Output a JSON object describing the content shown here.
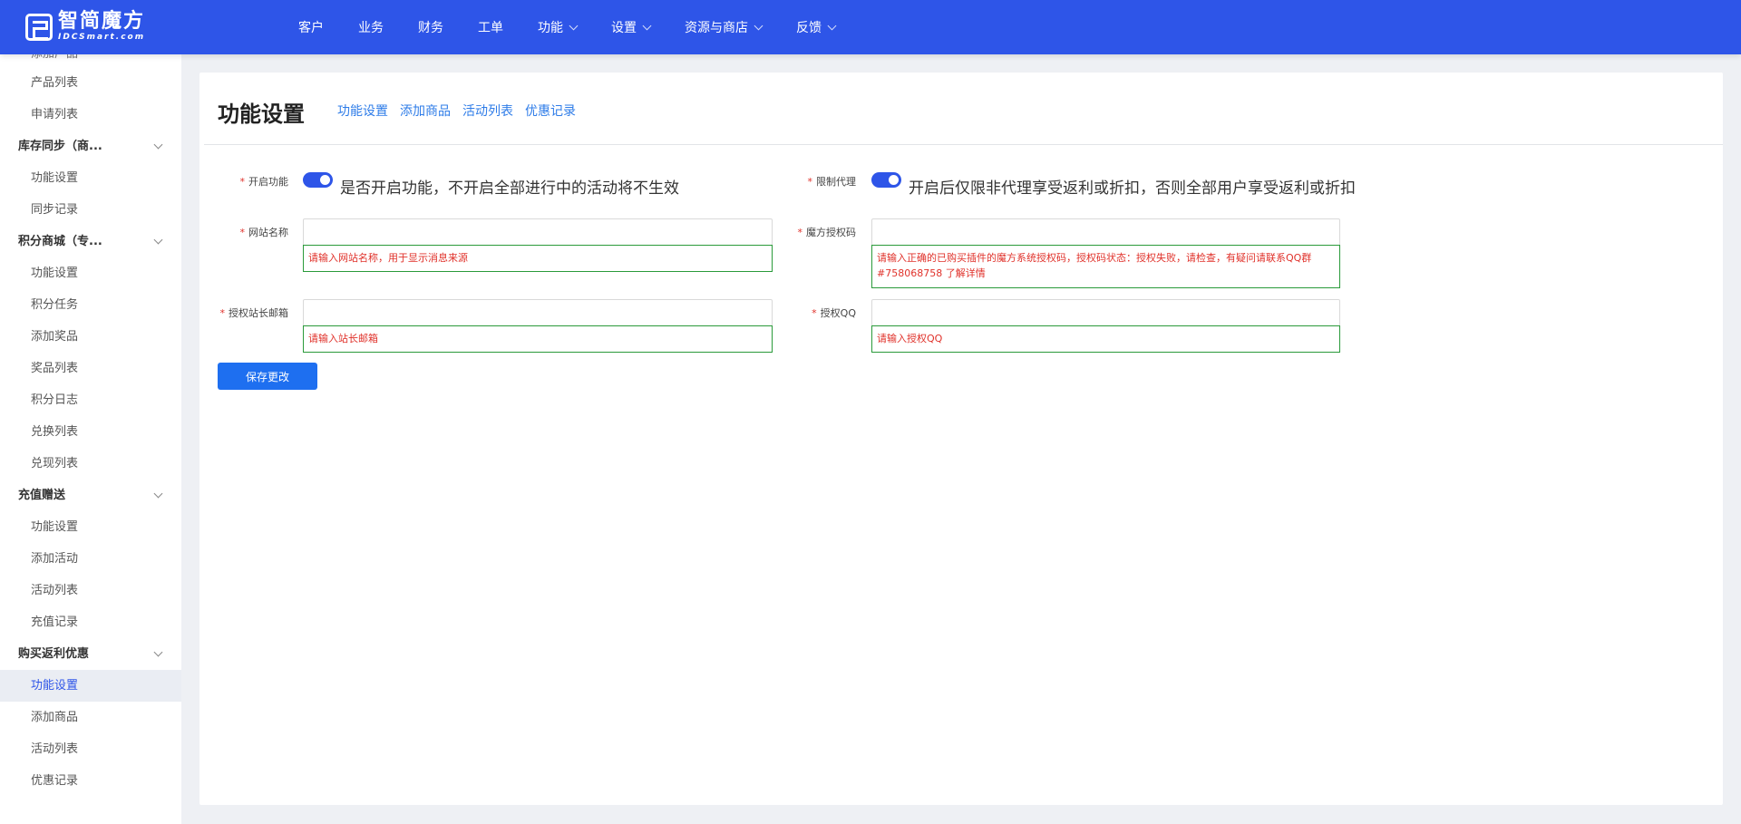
{
  "logo": {
    "cn": "智简魔方",
    "en": "IDCSmart.com"
  },
  "nav": [
    {
      "label": "客户",
      "dropdown": false
    },
    {
      "label": "业务",
      "dropdown": false
    },
    {
      "label": "财务",
      "dropdown": false
    },
    {
      "label": "工单",
      "dropdown": false
    },
    {
      "label": "功能",
      "dropdown": true
    },
    {
      "label": "设置",
      "dropdown": true
    },
    {
      "label": "资源与商店",
      "dropdown": true
    },
    {
      "label": "反馈",
      "dropdown": true
    }
  ],
  "sidebar": {
    "partial_top": "添加产品",
    "items": [
      {
        "type": "item",
        "label": "产品列表"
      },
      {
        "type": "item",
        "label": "申请列表"
      },
      {
        "type": "group",
        "label": "库存同步（商..."
      },
      {
        "type": "item",
        "label": "功能设置"
      },
      {
        "type": "item",
        "label": "同步记录"
      },
      {
        "type": "group",
        "label": "积分商城（专..."
      },
      {
        "type": "item",
        "label": "功能设置"
      },
      {
        "type": "item",
        "label": "积分任务"
      },
      {
        "type": "item",
        "label": "添加奖品"
      },
      {
        "type": "item",
        "label": "奖品列表"
      },
      {
        "type": "item",
        "label": "积分日志"
      },
      {
        "type": "item",
        "label": "兑换列表"
      },
      {
        "type": "item",
        "label": "兑现列表"
      },
      {
        "type": "group",
        "label": "充值赠送"
      },
      {
        "type": "item",
        "label": "功能设置"
      },
      {
        "type": "item",
        "label": "添加活动"
      },
      {
        "type": "item",
        "label": "活动列表"
      },
      {
        "type": "item",
        "label": "充值记录"
      },
      {
        "type": "group",
        "label": "购买返利优惠"
      },
      {
        "type": "item",
        "label": "功能设置",
        "active": true
      },
      {
        "type": "item",
        "label": "添加商品"
      },
      {
        "type": "item",
        "label": "活动列表"
      },
      {
        "type": "item",
        "label": "优惠记录"
      }
    ]
  },
  "page": {
    "title": "功能设置",
    "tabs": [
      "功能设置",
      "添加商品",
      "活动列表",
      "优惠记录"
    ]
  },
  "form": {
    "enable": {
      "required": "*",
      "label": "开启功能",
      "on": true,
      "hint": "是否开启功能，不开启全部进行中的活动将不生效"
    },
    "limit_agent": {
      "required": "*",
      "label": "限制代理",
      "on": true,
      "hint": "开启后仅限非代理享受返利或折扣，否则全部用户享受返利或折扣"
    },
    "site_name": {
      "required": "*",
      "label": "网站名称",
      "value": "",
      "error": "请输入网站名称，用于显示消息来源"
    },
    "license_code": {
      "required": "*",
      "label": "魔方授权码",
      "value": "",
      "error": "请输入正确的已购买插件的魔方系统授权码，授权码状态：授权失败，请检查，有疑问请联系QQ群#758068758 了解详情"
    },
    "admin_email": {
      "required": "*",
      "label": "授权站长邮箱",
      "value": "",
      "error": "请输入站长邮箱"
    },
    "license_qq": {
      "required": "*",
      "label": "授权QQ",
      "value": "",
      "error": "请输入授权QQ"
    },
    "save_label": "保存更改"
  },
  "colors": {
    "primary": "#2e55e8",
    "link": "#2e7ce8",
    "error_text": "#e0312a",
    "error_border": "#2a9a3a"
  }
}
